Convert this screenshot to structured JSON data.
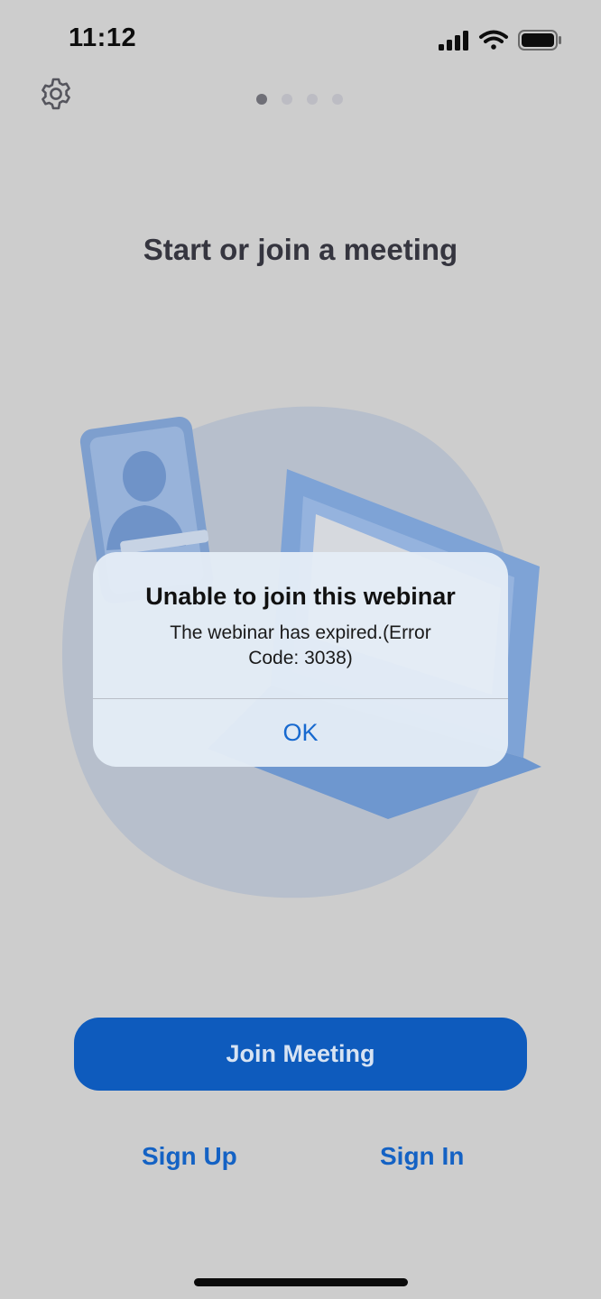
{
  "status_bar": {
    "time": "11:12",
    "icons": [
      "cellular-signal-icon",
      "wifi-icon",
      "battery-icon"
    ]
  },
  "header": {
    "settings_icon": "gear-icon",
    "page_indicator": {
      "total": 4,
      "active": 1
    }
  },
  "main": {
    "title": "Start or join a meeting"
  },
  "alert": {
    "title": "Unable to join this webinar",
    "message_line1": "The webinar has expired.(Error",
    "message_line2": "Code: 3038)",
    "ok_label": "OK"
  },
  "actions": {
    "join_label": "Join Meeting",
    "sign_up_label": "Sign Up",
    "sign_in_label": "Sign In"
  },
  "colors": {
    "background": "#cdcdcd",
    "primary": "#0e5bbd",
    "link": "#1462c4",
    "alert_bg": "#e4ecf6"
  }
}
